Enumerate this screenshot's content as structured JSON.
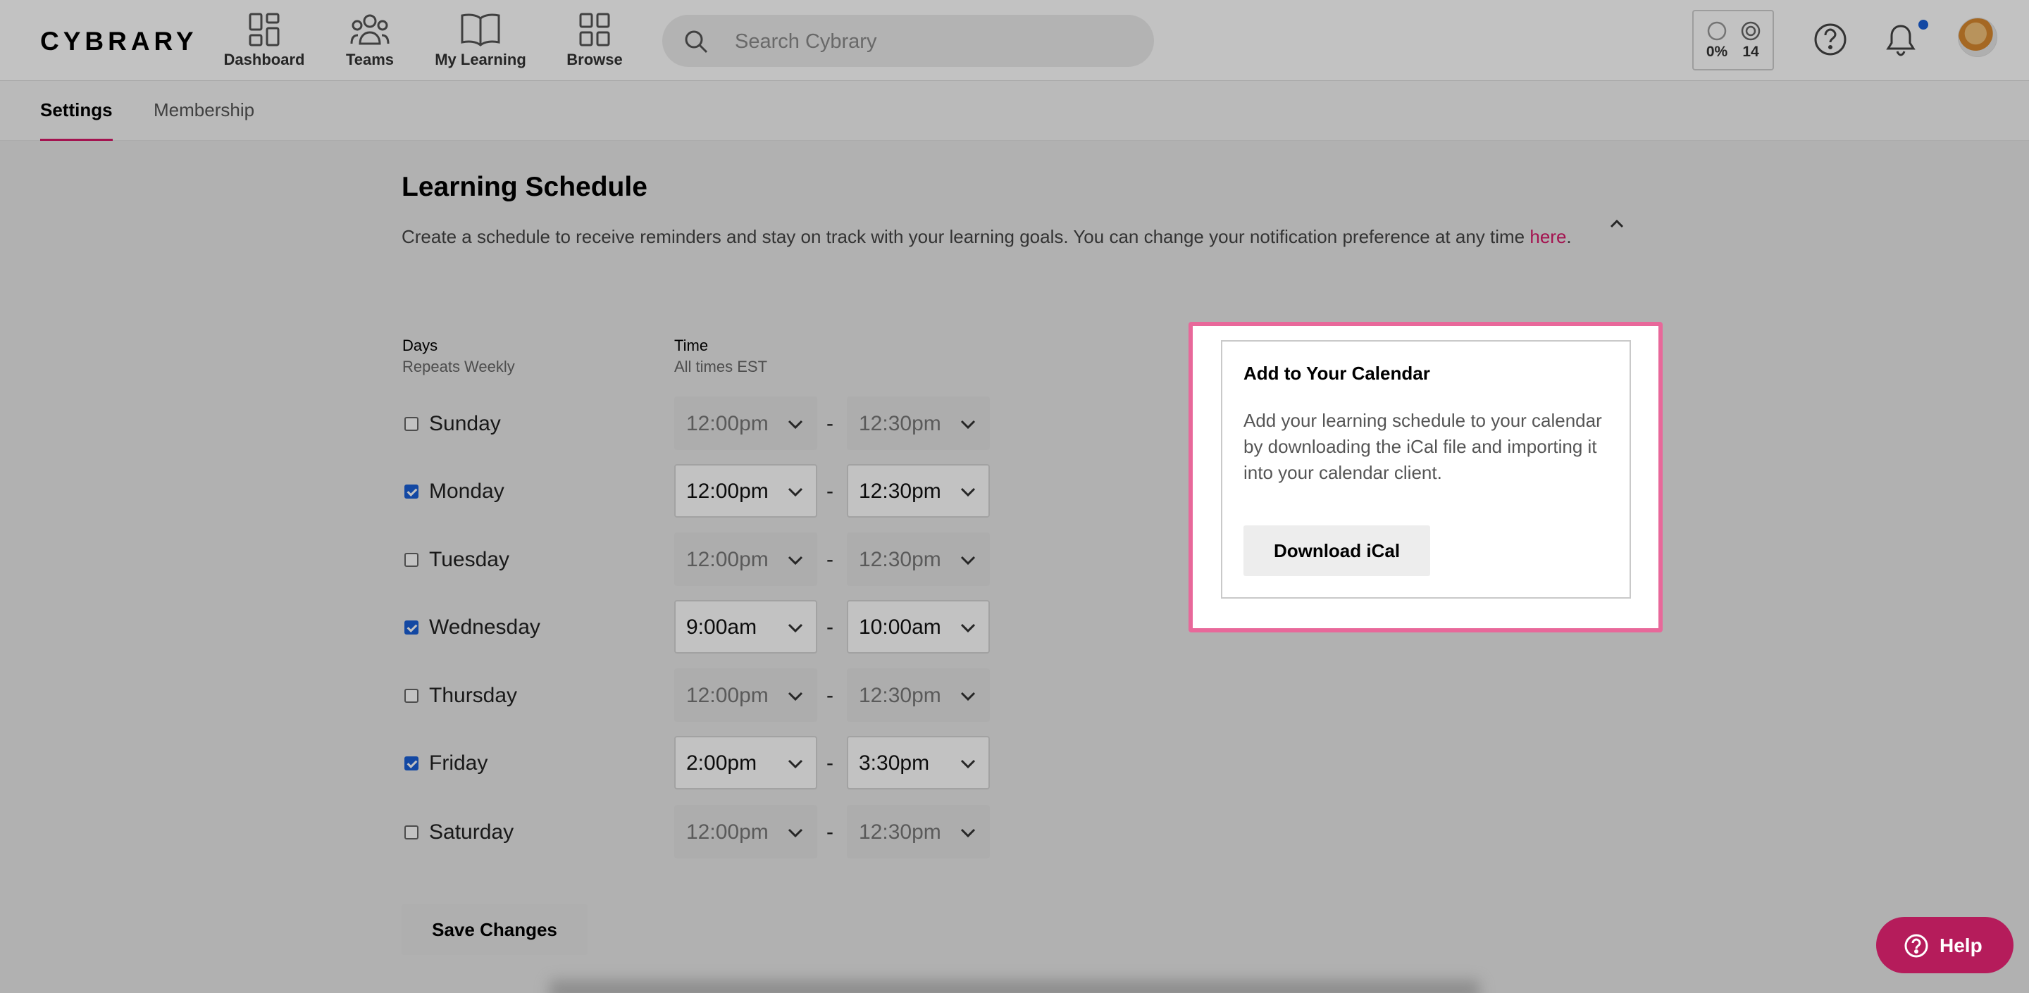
{
  "nav": {
    "logo": "CYBRARY",
    "items": [
      {
        "label": "Dashboard",
        "icon": "dashboard-icon"
      },
      {
        "label": "Teams",
        "icon": "teams-icon"
      },
      {
        "label": "My Learning",
        "icon": "book-icon"
      },
      {
        "label": "Browse",
        "icon": "browse-grid-icon"
      }
    ],
    "search_placeholder": "Search Cybrary",
    "stats": {
      "progress": "0%",
      "streak": "14"
    }
  },
  "subnav": {
    "tabs": [
      "Settings",
      "Membership"
    ],
    "active": "Settings"
  },
  "schedule": {
    "title": "Learning Schedule",
    "description": "Create a schedule to receive reminders and stay on track with your learning goals. You can change your notification preference at any time",
    "link_text": "here",
    "period": ".",
    "days_header": "Days",
    "days_sub": "Repeats Weekly",
    "time_header": "Time",
    "time_sub": "All times EST",
    "separator": "-",
    "days": [
      {
        "name": "Sunday",
        "checked": false,
        "start": "12:00pm",
        "end": "12:30pm"
      },
      {
        "name": "Monday",
        "checked": true,
        "start": "12:00pm",
        "end": "12:30pm"
      },
      {
        "name": "Tuesday",
        "checked": false,
        "start": "12:00pm",
        "end": "12:30pm"
      },
      {
        "name": "Wednesday",
        "checked": true,
        "start": "9:00am",
        "end": "10:00am"
      },
      {
        "name": "Thursday",
        "checked": false,
        "start": "12:00pm",
        "end": "12:30pm"
      },
      {
        "name": "Friday",
        "checked": true,
        "start": "2:00pm",
        "end": "3:30pm"
      },
      {
        "name": "Saturday",
        "checked": false,
        "start": "12:00pm",
        "end": "12:30pm"
      }
    ],
    "save_label": "Save Changes"
  },
  "calendar_card": {
    "title": "Add to Your Calendar",
    "text": "Add your learning schedule to your calendar by downloading the iCal file and importing it into your calendar client.",
    "button": "Download iCal"
  },
  "help": {
    "label": "Help"
  },
  "colors": {
    "accent": "#d81a6a",
    "highlight": "#e8689a",
    "checkbox": "#1a5fd6",
    "help": "#b51c5b"
  }
}
